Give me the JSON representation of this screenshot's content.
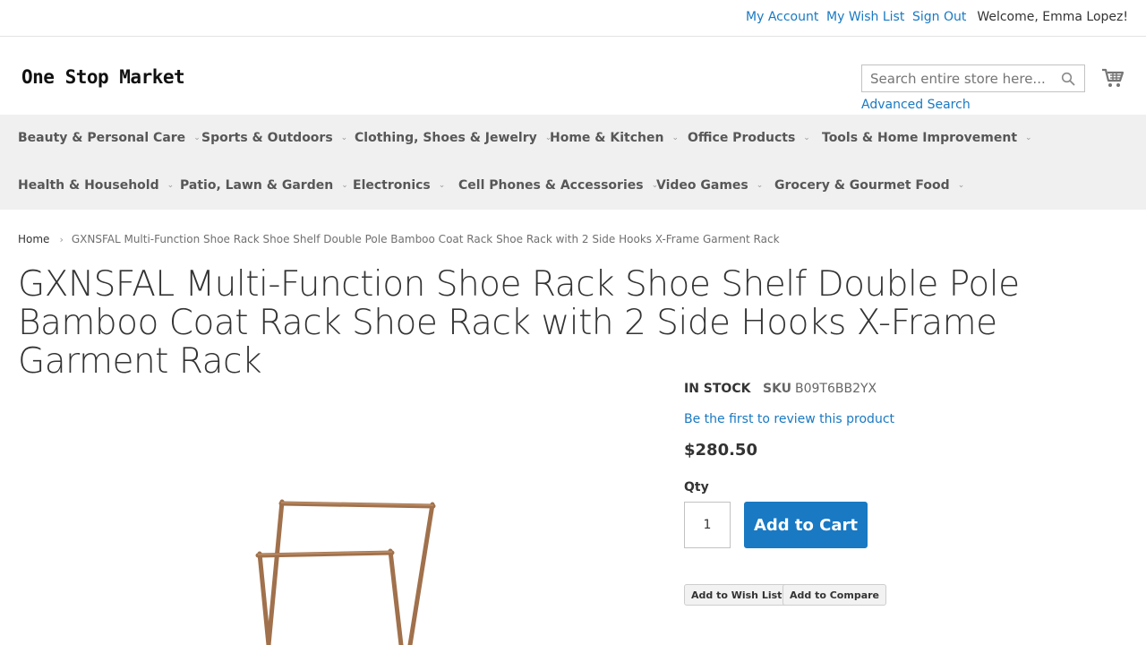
{
  "topbar": {
    "my_account": "My Account",
    "my_wish_list": "My Wish List",
    "sign_out": "Sign Out",
    "welcome": "Welcome, Emma Lopez!"
  },
  "header": {
    "logo_text": "One Stop Market",
    "search_placeholder": "Search entire store here...",
    "advanced_search": "Advanced Search",
    "search_icon": "search-icon",
    "cart_icon": "cart-icon"
  },
  "nav": {
    "items": [
      "Beauty & Personal Care",
      "Sports & Outdoors",
      "Clothing, Shoes & Jewelry",
      "Home & Kitchen",
      "Office Products",
      "Tools & Home Improvement",
      "Health & Household",
      "Patio, Lawn & Garden",
      "Electronics",
      "Cell Phones & Accessories",
      "Video Games",
      "Grocery & Gourmet Food"
    ]
  },
  "breadcrumb": {
    "home": "Home",
    "current": "GXNSFAL Multi-Function Shoe Rack Shoe Shelf Double Pole Bamboo Coat Rack Shoe Rack with 2 Side Hooks X-Frame Garment Rack"
  },
  "product": {
    "title": "GXNSFAL Multi-Function Shoe Rack Shoe Shelf Double Pole Bamboo Coat Rack Shoe Rack with 2 Side Hooks X-Frame Garment Rack",
    "stock": "IN STOCK",
    "sku_label": "SKU",
    "sku": "B09T6BB2YX",
    "review_link": "Be the first to review this product",
    "price": "$280.50",
    "qty_label": "Qty",
    "qty_value": "1",
    "add_to_cart": "Add to Cart",
    "add_to_wish_list": "Add to Wish List",
    "add_to_compare": "Add to Compare"
  },
  "colors": {
    "link": "#1979c3",
    "nav_bg": "#f0f0f0",
    "button_primary": "#1979c3"
  }
}
